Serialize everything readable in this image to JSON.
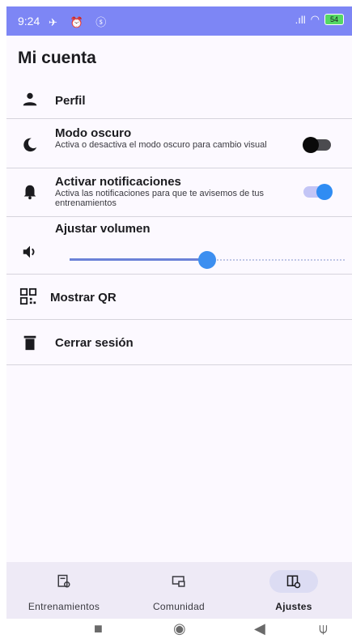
{
  "status_bar": {
    "time": "9:24",
    "icons": "✈ ⏰ ⓢ",
    "signal": ".ıll",
    "wifi": "◠",
    "battery": "54"
  },
  "page_title": "Mi cuenta",
  "settings": {
    "profile": {
      "label": "Perfil",
      "icon": "person-icon"
    },
    "dark_mode": {
      "label": "Modo oscuro",
      "description": "Activa o desactiva el modo oscuro para cambio visual",
      "icon": "moon-icon",
      "enabled": false
    },
    "notifications": {
      "label": "Activar notificaciones",
      "description": "Activa las notificaciones para que te avisemos de tus entrenamientos",
      "icon": "bell-icon",
      "enabled": true
    },
    "volume": {
      "label": "Ajustar volumen",
      "icon": "speaker-icon",
      "level": 0.5
    },
    "qr": {
      "label": "Mostrar QR",
      "icon": "qr-code-icon"
    },
    "logout": {
      "label": "Cerrar sesión",
      "icon": "trash-icon"
    }
  },
  "bottom_nav": {
    "items": [
      {
        "label": "Entrenamientos",
        "icon": "training-list-icon",
        "active": false
      },
      {
        "label": "Comunidad",
        "icon": "community-icon",
        "active": false
      },
      {
        "label": "Ajustes",
        "icon": "settings-book-icon",
        "active": true
      }
    ]
  },
  "system_nav": [
    "square-icon",
    "circle-icon",
    "back-triangle-icon",
    "accessibility-icon"
  ],
  "colors": {
    "accent": "#7d86f5",
    "switch_on": "#2f8cf3",
    "slider": "#3d8ff0"
  }
}
